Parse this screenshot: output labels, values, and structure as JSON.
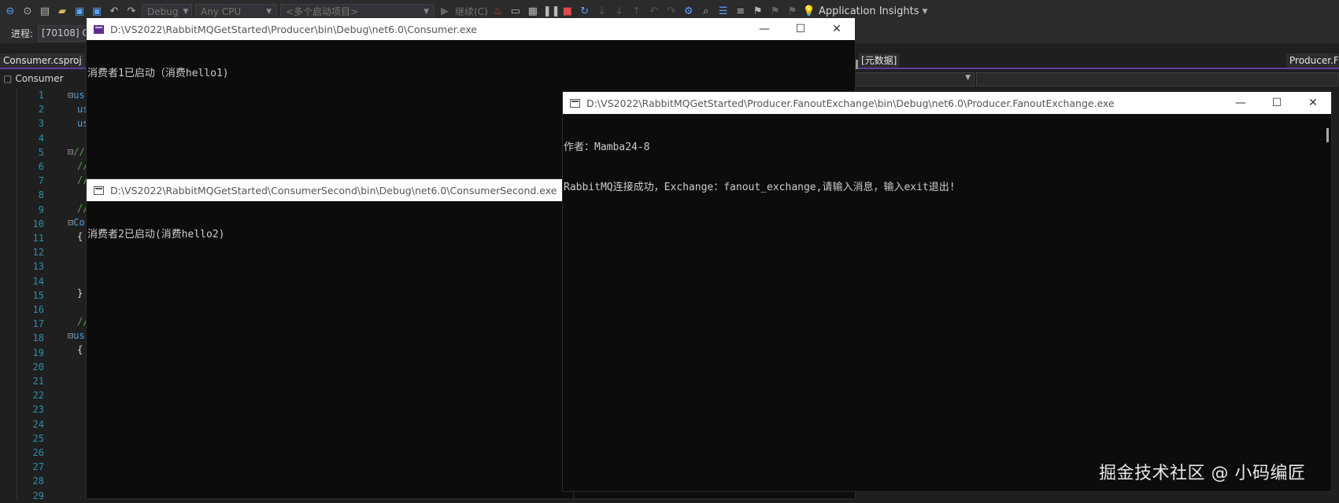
{
  "vs": {
    "toolbar": {
      "config": "Debug",
      "platform": "Any CPU",
      "startup": "<多个启动项目>",
      "continue": "继续(C)",
      "app_insights": "Application Insights"
    },
    "process_label": "进程:",
    "process_value": "[70108] C",
    "tabs": {
      "left": "Consumer.csproj",
      "middle": "[元数据]",
      "right": "Producer.F"
    },
    "nav_project": "Consumer",
    "line_numbers": [
      "1",
      "2",
      "3",
      "4",
      "5",
      "6",
      "7",
      "8",
      "9",
      "10",
      "11",
      "12",
      "13",
      "14",
      "15",
      "16",
      "17",
      "18",
      "19",
      "20",
      "21",
      "22",
      "23",
      "24",
      "25",
      "26",
      "27",
      "28",
      "29"
    ],
    "code": {
      "l1": "us",
      "l2": "us",
      "l3": "us",
      "l5": "//",
      "l6": "//",
      "l7": "//",
      "l9": "//",
      "l10": "Co",
      "l11": "{",
      "l15": "}",
      "l17": "//",
      "l18": "us",
      "l19": "{"
    }
  },
  "windows": {
    "consumer": {
      "title": "D:\\VS2022\\RabbitMQGetStarted\\Producer\\bin\\Debug\\net6.0\\Consumer.exe",
      "lines": [
        "消费者1已启动（消费hello1)"
      ]
    },
    "consumer_second": {
      "title": "D:\\VS2022\\RabbitMQGetStarted\\ConsumerSecond\\bin\\Debug\\net6.0\\ConsumerSecond.exe",
      "lines": [
        "消费者2已启动(消费hello2)"
      ]
    },
    "producer": {
      "title": "D:\\VS2022\\RabbitMQGetStarted\\Producer.FanoutExchange\\bin\\Debug\\net6.0\\Producer.FanoutExchange.exe",
      "lines": [
        "作者：Mamba24-8",
        "RabbitMQ连接成功，Exchange：fanout_exchange,请输入消息，输入exit退出!"
      ]
    }
  },
  "watermark": "掘金技术社区 @ 小码编匠"
}
